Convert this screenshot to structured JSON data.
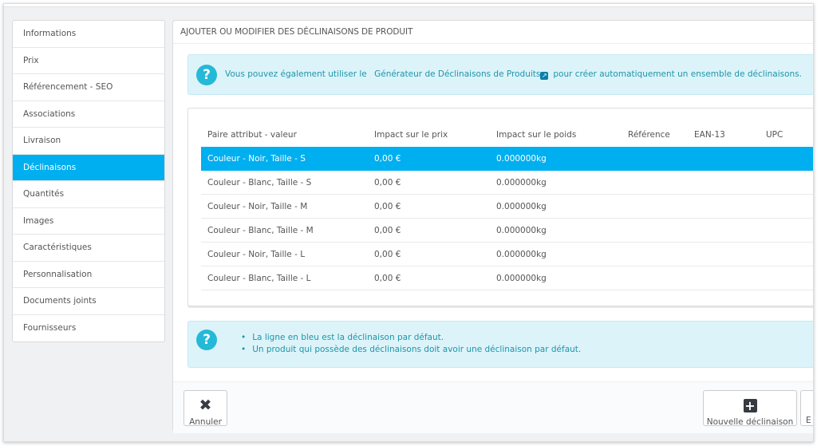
{
  "sidebar": {
    "items": [
      {
        "label": "Informations"
      },
      {
        "label": "Prix"
      },
      {
        "label": "Référencement - SEO"
      },
      {
        "label": "Associations"
      },
      {
        "label": "Livraison"
      },
      {
        "label": "Déclinaisons",
        "active": true
      },
      {
        "label": "Quantités"
      },
      {
        "label": "Images"
      },
      {
        "label": "Caractéristiques"
      },
      {
        "label": "Personnalisation"
      },
      {
        "label": "Documents joints"
      },
      {
        "label": "Fournisseurs"
      }
    ]
  },
  "panel": {
    "title": "AJOUTER OU MODIFIER DES DÉCLINAISONS DE PRODUIT"
  },
  "info": {
    "prefix": "Vous pouvez également utiliser le",
    "link": "Générateur de Déclinaisons de Produits",
    "suffix": "pour créer automatiquement un ensemble de déclinaisons."
  },
  "table": {
    "columns": [
      "Paire attribut - valeur",
      "Impact sur le prix",
      "Impact sur le poids",
      "Référence",
      "EAN-13",
      "UPC"
    ],
    "rows": [
      {
        "pair": "Couleur - Noir, Taille - S",
        "price": "0,00 €",
        "weight": "0.000000kg",
        "ref": "",
        "ean": "",
        "upc": "",
        "selected": true
      },
      {
        "pair": "Couleur - Blanc, Taille - S",
        "price": "0,00 €",
        "weight": "0.000000kg",
        "ref": "",
        "ean": "",
        "upc": ""
      },
      {
        "pair": "Couleur - Noir, Taille - M",
        "price": "0,00 €",
        "weight": "0.000000kg",
        "ref": "",
        "ean": "",
        "upc": ""
      },
      {
        "pair": "Couleur - Blanc, Taille - M",
        "price": "0,00 €",
        "weight": "0.000000kg",
        "ref": "",
        "ean": "",
        "upc": ""
      },
      {
        "pair": "Couleur - Noir, Taille - L",
        "price": "0,00 €",
        "weight": "0.000000kg",
        "ref": "",
        "ean": "",
        "upc": ""
      },
      {
        "pair": "Couleur - Blanc, Taille - L",
        "price": "0,00 €",
        "weight": "0.000000kg",
        "ref": "",
        "ean": "",
        "upc": ""
      }
    ]
  },
  "notes": [
    "La ligne en bleu est la déclinaison par défaut.",
    "Un produit qui possède des déclinaisons doit avoir une déclinaison par défaut."
  ],
  "footer": {
    "cancel_label": "Annuler",
    "new_label": "Nouvelle déclinaison",
    "partial_label": "E"
  },
  "icons": {
    "info": "question-circle-icon",
    "external": "external-link-icon",
    "cancel": "close-icon",
    "add": "plus-square-icon"
  },
  "colors": {
    "accent": "#00aff0",
    "info_bg": "#dcf4f9",
    "info_text": "#1e94ab"
  }
}
